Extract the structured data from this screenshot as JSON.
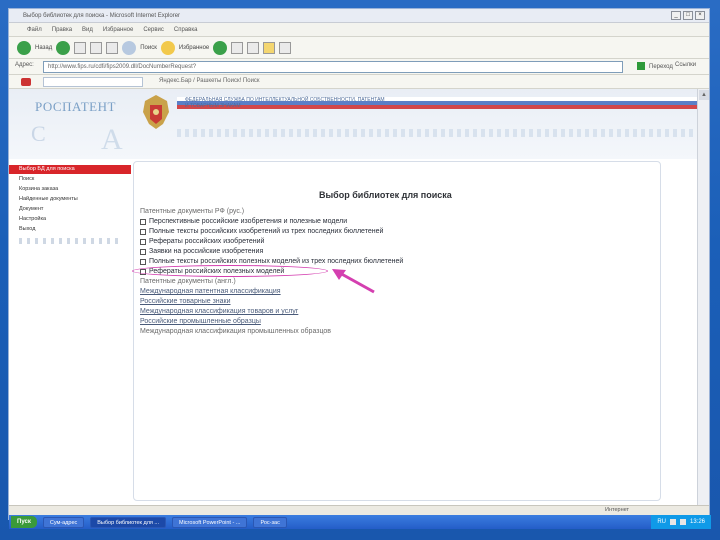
{
  "browser": {
    "window_title": "Выбор библиотек для поиска - Microsoft Internet Explorer",
    "menu": [
      "Файл",
      "Правка",
      "Вид",
      "Избранное",
      "Сервис",
      "Справка"
    ],
    "toolbar": {
      "back_label": "Назад",
      "search_label": "Поиск",
      "favorites_label": "Избранное"
    },
    "address_label": "Адрес:",
    "address_value": "http://www.fips.ru/cdfi/fips2009.dll/DocNumberRequest?",
    "go_label": "Переход",
    "links_label": "Ссылки",
    "links_bar_text": "Яндекс.Бар / Рашкеты Поиск! Поиск",
    "status_zone": "Интернет"
  },
  "site": {
    "logo_text": "РОСПАТЕНТ",
    "org_title": "ФЕДЕРАЛЬНАЯ СЛУЖБА ПО ИНТЕЛЛЕКТУАЛЬНОЙ СОБСТВЕННОСТИ, ПАТЕНТАМ И ТОВАРНЫМ ЗНАКАМ",
    "header_letter_c": "С",
    "header_letter_a": "А"
  },
  "sidebar": {
    "items": [
      {
        "label": "Выбор БД для поиска",
        "active": true
      },
      {
        "label": "Поиск",
        "active": false
      },
      {
        "label": "Корзина заказа",
        "active": false
      },
      {
        "label": "Найденные документы",
        "active": false
      },
      {
        "label": "Документ",
        "active": false
      },
      {
        "label": "Настройка",
        "active": false
      },
      {
        "label": "Выход",
        "active": false
      }
    ]
  },
  "main": {
    "title": "Выбор библиотек для поиска",
    "patent_group_label": "Патентные документы РФ (рус.)",
    "checkbox_items": [
      "Перспективные российские изобретения и полезные модели",
      "Полные тексты российских изобретений из трех последних бюллетеней",
      "Рефераты российских изобретений",
      "Заявки на российские изобретения",
      "Полные тексты российских полезных моделей из трех последних бюллетеней",
      "Рефераты российских полезных моделей"
    ],
    "patent_docs_link": "Патентные документы (англ.)",
    "links": [
      "Международная патентная классификация",
      "Российские товарные знаки",
      "Международная классификация товаров и услуг",
      "Российские промышленные образцы",
      "Международная классификация промышленных образцов"
    ]
  },
  "taskbar": {
    "start_label": "Пуск",
    "tasks": [
      {
        "label": "Сум-адрес",
        "active": false
      },
      {
        "label": "Выбор библиотек для ...",
        "active": true
      },
      {
        "label": "Microsoft PowerPoint - ...",
        "active": false
      },
      {
        "label": "Рос-зас",
        "active": false
      }
    ],
    "tray_lang": "RU",
    "tray_time": "13:26"
  },
  "colors": {
    "sidebar_active_bg": "#d8252a",
    "highlight_ellipse": "#d43fb0",
    "arrow": "#d43fb0",
    "desktop_blue": "#1b5fb8"
  }
}
